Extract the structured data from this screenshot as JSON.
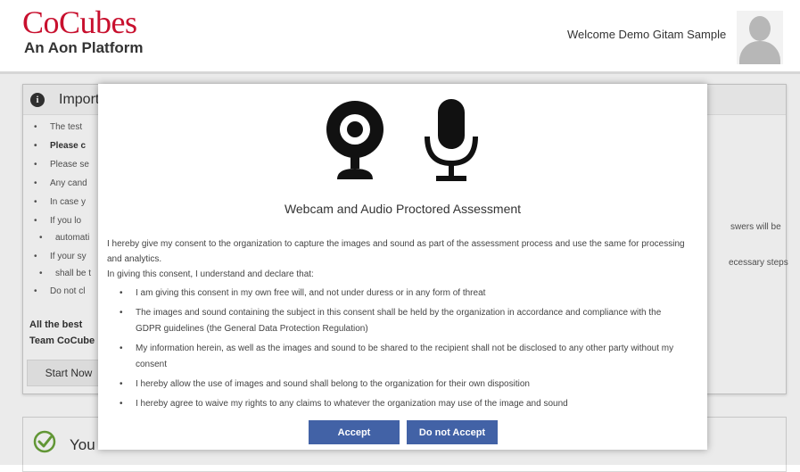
{
  "header": {
    "logo_main": "CoCubes",
    "logo_sub": "An Aon Platform",
    "welcome": "Welcome Demo Gitam Sample"
  },
  "background": {
    "panel_title": "Import",
    "list_items": [
      "The test",
      "Please c",
      "Please se",
      "Any cand",
      "In case y",
      "If you lo",
      "automati",
      "If your sy",
      "shall be t",
      "Do not cl"
    ],
    "right_fragments": [
      "swers will be",
      "ecessary steps"
    ],
    "sign_line1": "All the best",
    "sign_line2": "Team CoCube",
    "start_button": "Start Now",
    "card2_text": "You"
  },
  "modal": {
    "title": "Webcam and Audio Proctored Assessment",
    "intro": "I hereby give my consent to the organization to capture the images and sound as part of the assessment process and use the same for processing and analytics.",
    "declare": "In giving this consent, I understand and declare that:",
    "items": [
      "I am giving this consent in my own free will, and not under duress or in any form of threat",
      "The images and sound containing the subject in this consent shall be held by the organization in accordance and compliance with the GDPR guidelines (the General Data Protection Regulation)",
      "My information herein, as well as the images and sound to be shared to the recipient shall not be disclosed to any other party without my consent",
      "I hereby allow the use of images and sound shall belong to the organization for their own disposition",
      "I hereby agree to waive my rights to any claims to whatever the organization may use of the image and sound"
    ],
    "accept_label": "Accept",
    "decline_label": "Do not Accept"
  },
  "colors": {
    "brand_red": "#c8102e",
    "button_blue": "#4262a6"
  },
  "icons": [
    "info-icon",
    "webcam-icon",
    "microphone-icon",
    "user-avatar-icon",
    "check-circle-icon"
  ]
}
